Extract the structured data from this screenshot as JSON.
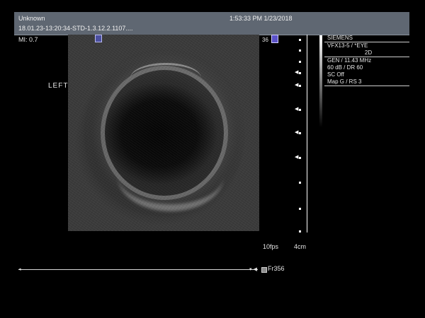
{
  "header": {
    "patient_name": "Unknown",
    "datetime": "1:53:33 PM 1/23/2018",
    "study_id": "18.01.23-13:20:34-STD-1.3.12.2.1107...."
  },
  "mechanical_index": "MI: 0.7",
  "orientation_label": "LEFT",
  "depth_number": "36",
  "info_panel": {
    "vendor": "SIEMENS",
    "transducer": "VFX13-5 / *EYE",
    "mode": "2D",
    "frequency": "GEN / 11.43 MHz",
    "gain_range": "60 dB / DR 60",
    "sc": "SC Off",
    "map": "Map G / RS 3"
  },
  "frame_rate": "10fps",
  "depth_scale": "4cm",
  "cine": {
    "frame": "Fr356"
  },
  "icons": {
    "probe_marker": "probe-orientation-marker",
    "cine_start": "triangle-marker",
    "cine_end": "triangle-down-marker"
  },
  "colors": {
    "header_bar": "#5f6772",
    "marker": "#4b4fa0"
  }
}
